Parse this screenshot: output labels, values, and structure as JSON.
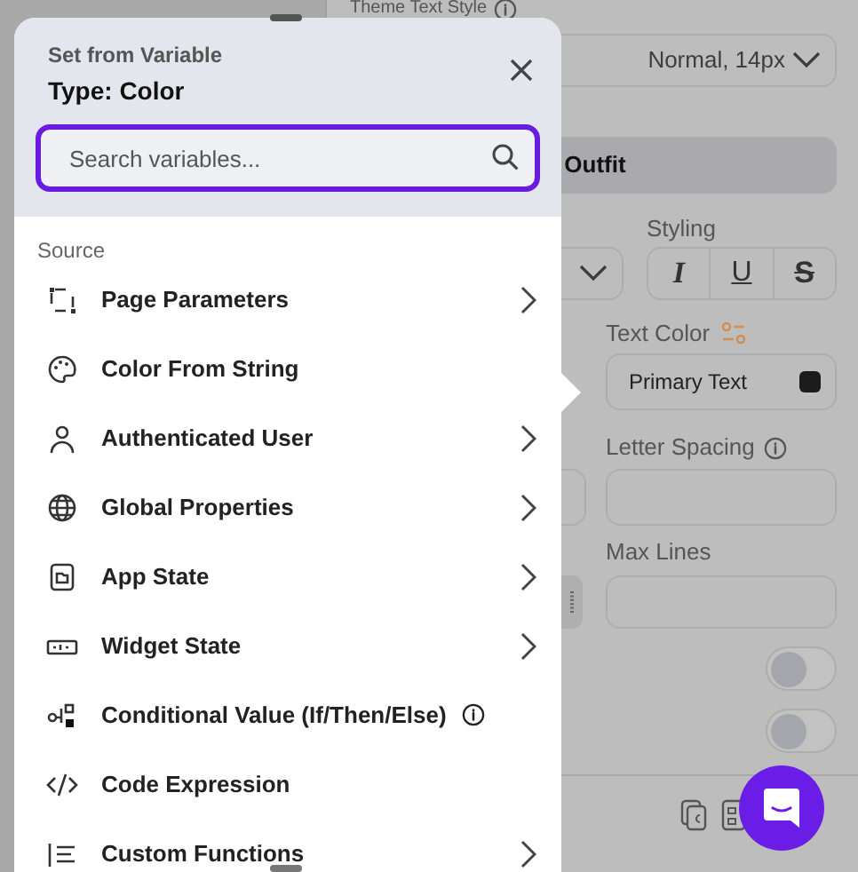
{
  "properties_panel": {
    "theme_text_style_label": "Theme Text Style",
    "text_style_value": "Normal, 14px",
    "font_family": "Outfit",
    "styling_label": "Styling",
    "styling_buttons": [
      "I",
      "U",
      "S"
    ],
    "text_color_label": "Text Color",
    "text_color_value": "Primary Text",
    "letter_spacing_label": "Letter Spacing",
    "max_lines_label": "Max Lines",
    "toggles": [
      {
        "on": false
      },
      {
        "on": false
      }
    ]
  },
  "variable_picker": {
    "subtitle": "Set from Variable",
    "title": "Type: Color",
    "search": {
      "placeholder": "Search variables..."
    },
    "section_label": "Source",
    "items": [
      {
        "label": "Page Parameters",
        "has_submenu": true,
        "info": false
      },
      {
        "label": "Color From String",
        "has_submenu": false,
        "info": false
      },
      {
        "label": "Authenticated User",
        "has_submenu": true,
        "info": false
      },
      {
        "label": "Global Properties",
        "has_submenu": true,
        "info": false
      },
      {
        "label": "App State",
        "has_submenu": true,
        "info": false
      },
      {
        "label": "Widget State",
        "has_submenu": true,
        "info": false
      },
      {
        "label": "Conditional Value (If/Then/Else)",
        "has_submenu": false,
        "info": true
      },
      {
        "label": "Code Expression",
        "has_submenu": false,
        "info": false
      },
      {
        "label": "Custom Functions",
        "has_submenu": true,
        "info": false
      }
    ]
  }
}
